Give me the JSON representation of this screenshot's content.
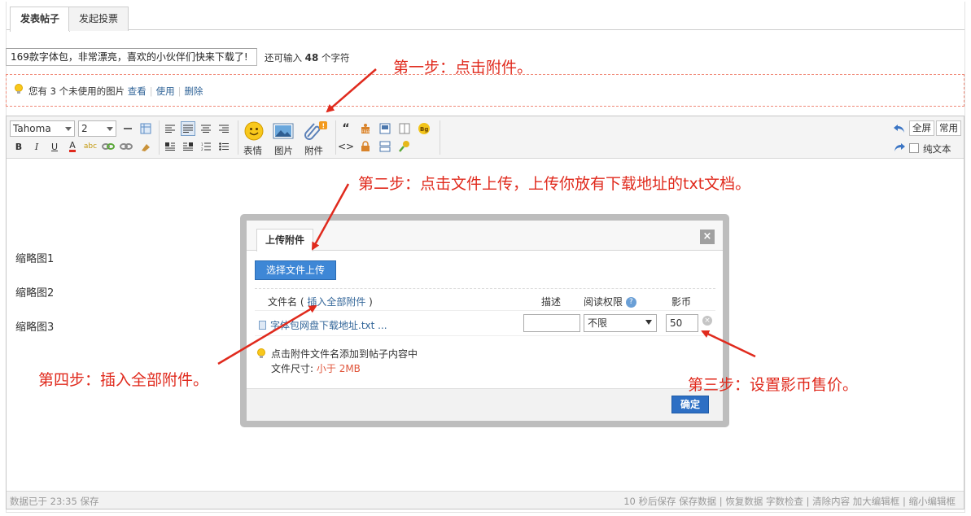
{
  "tabs": [
    {
      "label": "发表帖子",
      "active": true
    },
    {
      "label": "发起投票",
      "active": false
    }
  ],
  "subject": {
    "value": "169款字体包，非常漂亮，喜欢的小伙伴们快来下载了!",
    "counter_prefix": "还可输入",
    "counter_value": "48",
    "counter_suffix": "个字符"
  },
  "notice": {
    "text": "您有 3 个未使用的图片",
    "links": [
      "查看",
      "使用",
      "删除"
    ]
  },
  "toolbar": {
    "font": "Tahoma",
    "size": "2",
    "emoji_label": "表情",
    "image_label": "图片",
    "attach_label": "附件",
    "fullscreen": "全屏",
    "common": "常用",
    "plain_text": "纯文本"
  },
  "editor_body": {
    "lines": [
      "缩略图1",
      "缩略图2",
      "缩略图3"
    ]
  },
  "statusbar": {
    "left": "数据已于 23:35 保存",
    "right": "10 秒后保存 保存数据 | 恢复数据    字数检查 | 清除内容    加大编辑框 | 缩小编辑框"
  },
  "dialog": {
    "tab": "上传附件",
    "close": "×",
    "upload_button": "选择文件上传",
    "col_filename": "文件名",
    "insert_all": "插入全部附件",
    "col_desc": "描述",
    "col_perm": "阅读权限",
    "col_price": "影币",
    "file": {
      "name": "字体包网盘下载地址.txt ...",
      "desc": "",
      "perm": "不限",
      "price": "50"
    },
    "tip_line1": "点击附件文件名添加到帖子内容中",
    "tip_size_label": "文件尺寸:",
    "tip_size_value": "小于 2MB",
    "ok": "确定"
  },
  "annotations": {
    "step1": "第一步：点击附件。",
    "step2": "第二步：点击文件上传，上传你放有下载地址的txt文档。",
    "step3": "第三步：设置影币售价。",
    "step4": "第四步：插入全部附件。"
  },
  "colors": {
    "annotation": "#e02a1d",
    "link": "#336699",
    "primary_button": "#3e87d6"
  }
}
